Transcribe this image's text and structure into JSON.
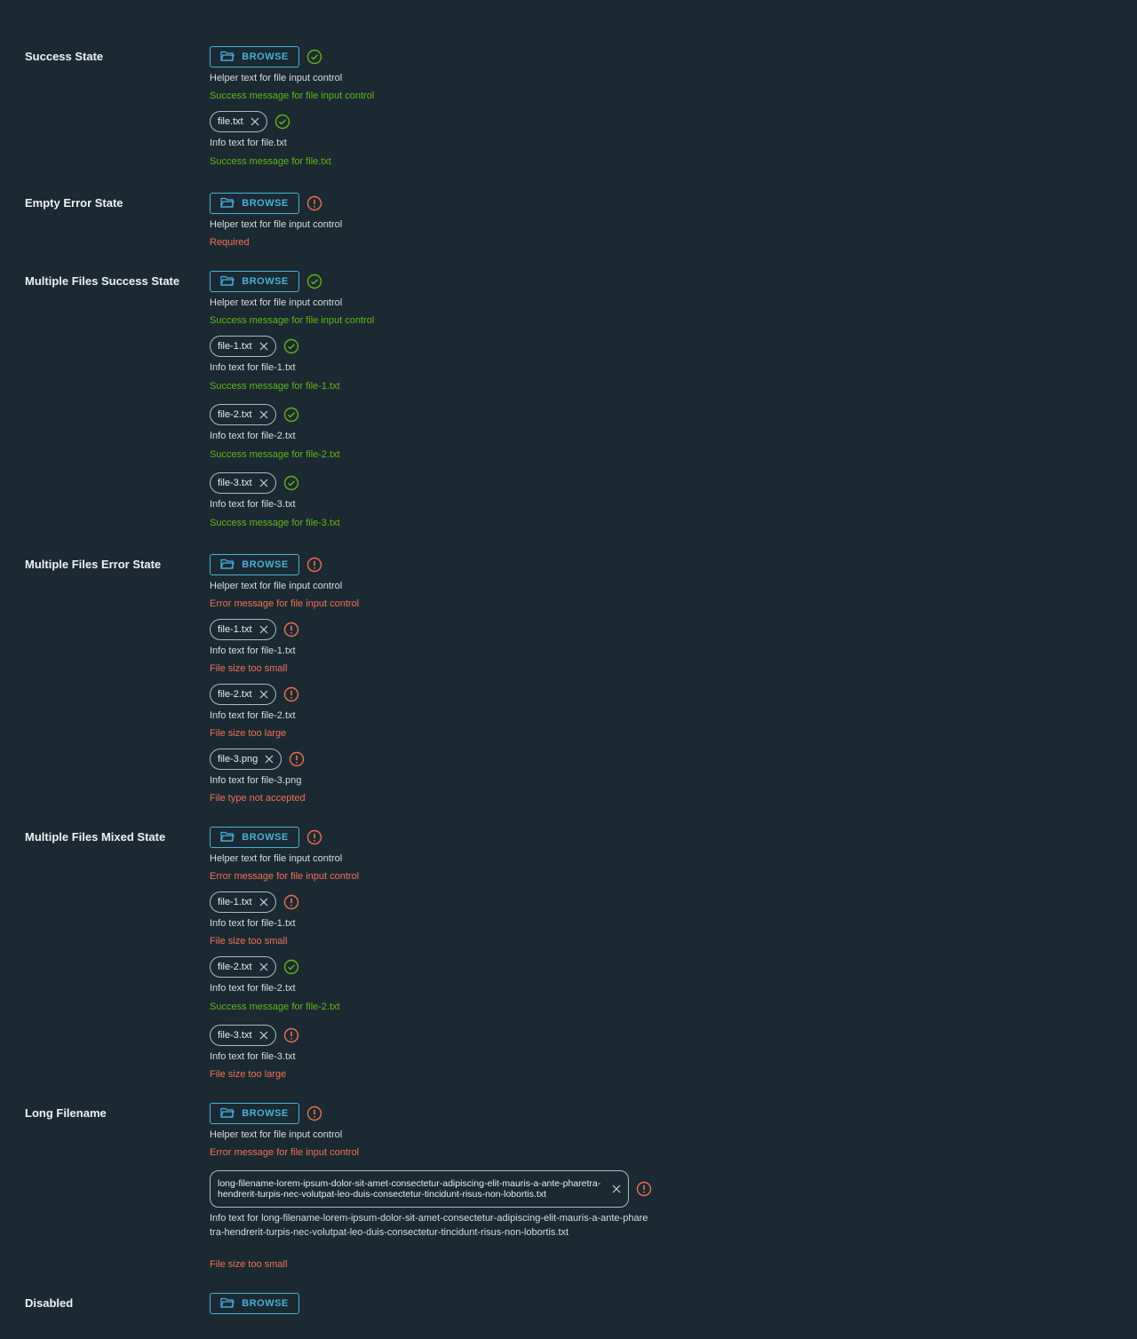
{
  "browse_label": "BROWSE",
  "helper": "Helper text for file input control",
  "colors": {
    "background": "#1b2a32",
    "accent": "#49afd9",
    "success": "#60b515",
    "error": "#f06e56"
  },
  "icons": {
    "browse": "folder-open-icon",
    "success": "check-circle-icon",
    "error": "exclamation-circle-icon",
    "remove": "close-icon"
  },
  "success_state": {
    "label": "Success State",
    "message": "Success message for file input control",
    "files": [
      {
        "name": "file.txt",
        "info": "Info text for file.txt",
        "message": "Success message for file.txt"
      }
    ]
  },
  "empty_error": {
    "label": "Empty Error State",
    "message": "Required"
  },
  "multi_success": {
    "label": "Multiple Files Success State",
    "message": "Success message for file input control",
    "files": [
      {
        "name": "file-1.txt",
        "info": "Info text for file-1.txt",
        "message": "Success message for file-1.txt"
      },
      {
        "name": "file-2.txt",
        "info": "Info text for file-2.txt",
        "message": "Success message for file-2.txt"
      },
      {
        "name": "file-3.txt",
        "info": "Info text for file-3.txt",
        "message": "Success message for file-3.txt"
      }
    ]
  },
  "multi_error": {
    "label": "Multiple Files Error State",
    "message": "Error message for file input control",
    "files": [
      {
        "name": "file-1.txt",
        "info": "Info text for file-1.txt",
        "message": "File size too small"
      },
      {
        "name": "file-2.txt",
        "info": "Info text for file-2.txt",
        "message": "File size too large"
      },
      {
        "name": "file-3.png",
        "info": "Info text for file-3.png",
        "message": "File type not accepted"
      }
    ]
  },
  "multi_mixed": {
    "label": "Multiple Files Mixed State",
    "message": "Error message for file input control",
    "files": [
      {
        "name": "file-1.txt",
        "info": "Info text for file-1.txt",
        "message": "File size too small"
      },
      {
        "name": "file-2.txt",
        "info": "Info text for file-2.txt",
        "message": "Success message for file-2.txt"
      },
      {
        "name": "file-3.txt",
        "info": "Info text for file-3.txt",
        "message": "File size too large"
      }
    ]
  },
  "long_filename": {
    "label": "Long Filename",
    "message": "Error message for file input control",
    "file": {
      "name": "long-filename-lorem-ipsum-dolor-sit-amet-consectetur-adipiscing-elit-mauris-a-ante-pharetra-hendrerit-turpis-nec-volutpat-leo-duis-consectetur-tincidunt-risus-non-lobortis.txt",
      "info": "Info text for long-filename-lorem-ipsum-dolor-sit-amet-consectetur-adipiscing-elit-mauris-a-ante-pharetra-hendrerit-turpis-nec-volutpat-leo-duis-consectetur-tincidunt-risus-non-lobortis.txt",
      "message": "File size too small"
    }
  },
  "disabled": {
    "label": "Disabled"
  }
}
